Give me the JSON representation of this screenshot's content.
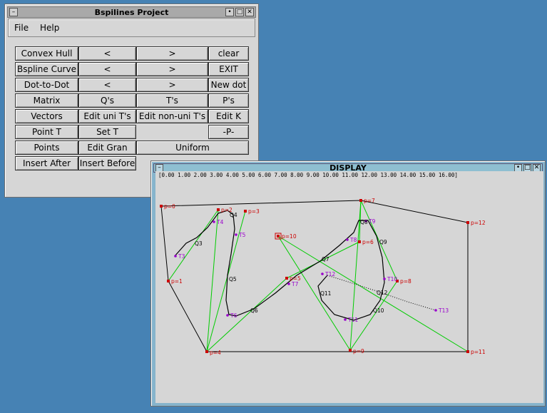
{
  "main_window": {
    "title": "Bspilines Project",
    "menu": [
      "File",
      "Help"
    ]
  },
  "buttons": {
    "convex_hull": "Convex Hull",
    "bspline_curve": "Bspline Curve",
    "dot_to_dot": "Dot-to-Dot",
    "prev": "<",
    "next": ">",
    "clear": "clear",
    "exit": "EXIT",
    "new_dot": "New dot",
    "matrix": "Matrix",
    "qs": "Q's",
    "ts": "T's",
    "ps": "P's",
    "vectors": "Vectors",
    "edit_uni": "Edit uni T's",
    "edit_nonuni": "Edit non-uni T's",
    "edit_k": "Edit K",
    "point_t": "Point T",
    "set_t": "Set T",
    "p_minus": "-P-",
    "points": "Points",
    "edit_gran": "Edit Gran",
    "uniform": "Uniform",
    "insert_after": "Insert After",
    "insert_before": "Insert Before"
  },
  "display_window": {
    "title": "DISPLAY",
    "t_values": "[0.00 1.00 2.00 3.00 4.00 5.00 6.00 7.00 8.00 9.00 10.00 11.00 12.00 13.00 14.00 15.00 16.00]"
  },
  "control_points": [
    {
      "label": "p=0"
    },
    {
      "label": "p=1"
    },
    {
      "label": "p=2"
    },
    {
      "label": "p=3"
    },
    {
      "label": "p=4"
    },
    {
      "label": "p=5"
    },
    {
      "label": "p=6"
    },
    {
      "label": "p=7"
    },
    {
      "label": "p=8"
    },
    {
      "label": "p=9"
    },
    {
      "label": "p=10"
    },
    {
      "label": "p=11"
    },
    {
      "label": "p=12"
    }
  ],
  "knot_labels": [
    "T3",
    "T4",
    "T5",
    "T6",
    "T7",
    "T8",
    "T9",
    "T10",
    "T11",
    "T12",
    "T13"
  ],
  "q_labels": [
    "Q3",
    "Q4",
    "Q5",
    "Q6",
    "Q7",
    "Q8",
    "Q9",
    "Q10",
    "Q11",
    "Q12"
  ],
  "colors": {
    "desktop": "#4682b4",
    "hull": "#000000",
    "segments": "#00cc00",
    "control_point": "#cc0000",
    "knot": "#9900cc"
  }
}
